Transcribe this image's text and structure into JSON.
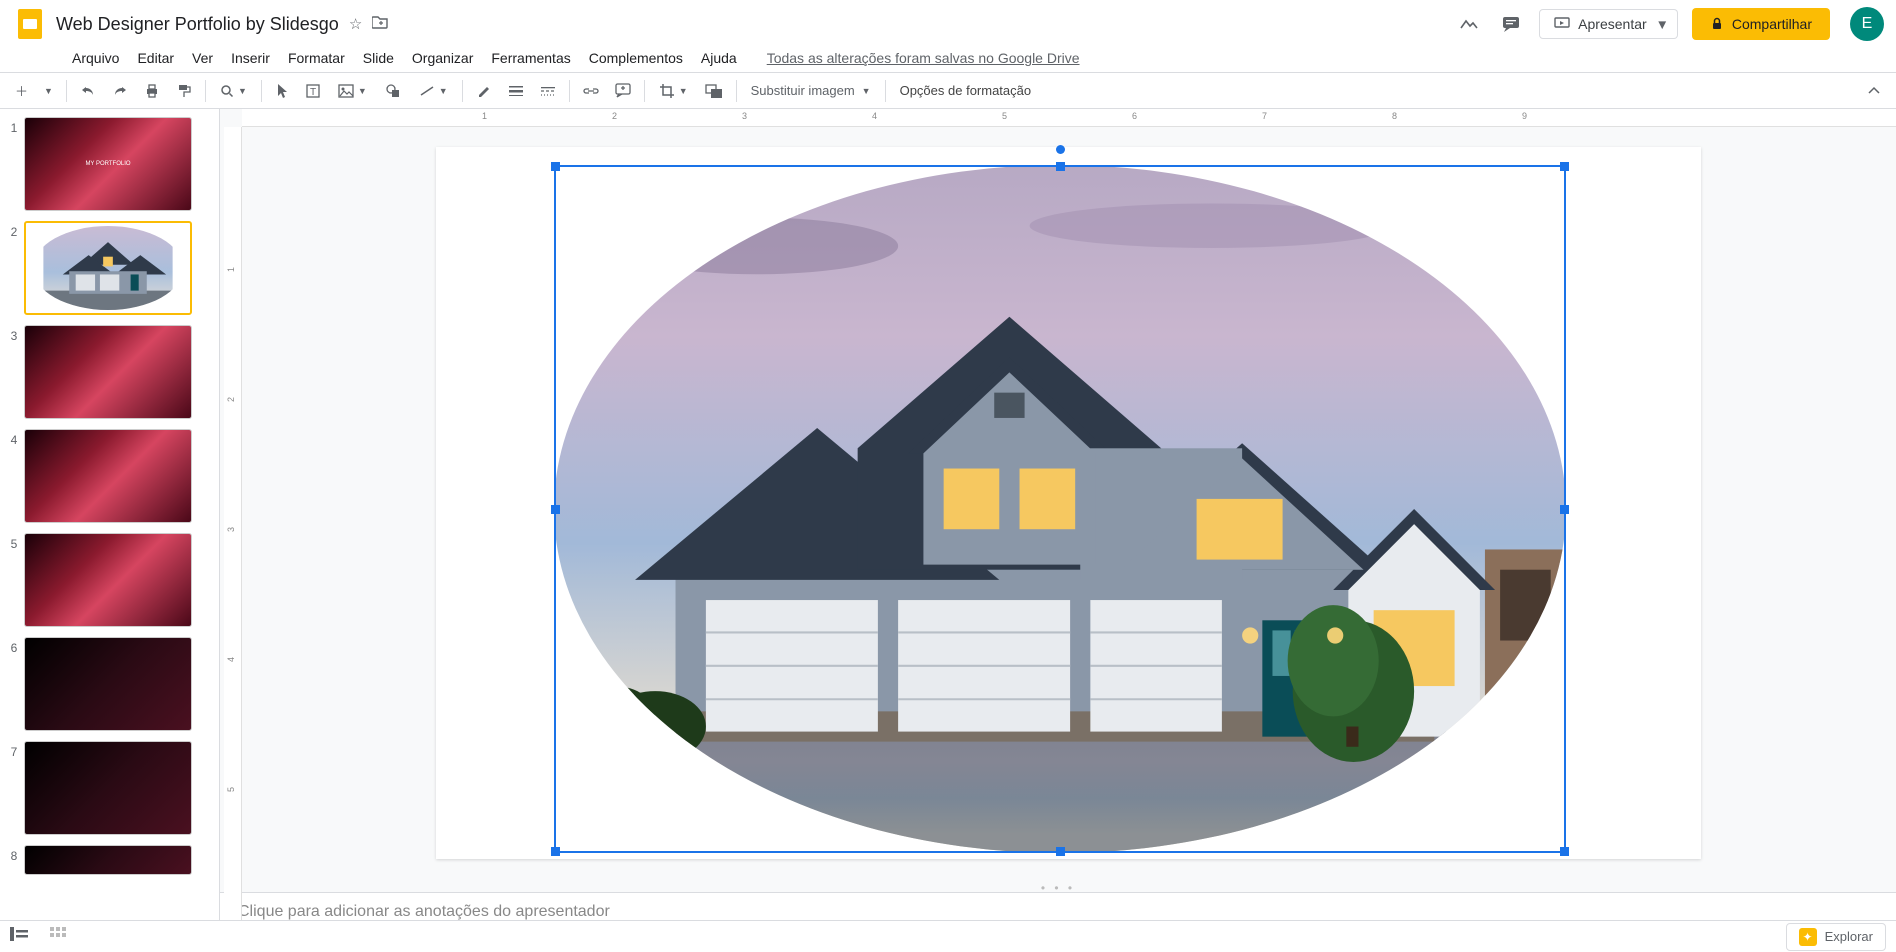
{
  "title": "Web Designer Portfolio by Slidesgo",
  "menubar": [
    "Arquivo",
    "Editar",
    "Ver",
    "Inserir",
    "Formatar",
    "Slide",
    "Organizar",
    "Ferramentas",
    "Complementos",
    "Ajuda"
  ],
  "save_status": "Todas as alterações foram salvas no Google Drive",
  "present_label": "Apresentar",
  "share_label": "Compartilhar",
  "avatar_letter": "E",
  "toolbar": {
    "replace_image": "Substituir imagem",
    "format_options": "Opções de formatação"
  },
  "ruler_h": [
    "",
    "1",
    "2",
    "3",
    "4",
    "5",
    "6",
    "7",
    "8",
    "9"
  ],
  "ruler_v": [
    "1",
    "2",
    "3",
    "4",
    "5"
  ],
  "thumbs": [
    "1",
    "2",
    "3",
    "4",
    "5",
    "6",
    "7",
    "8"
  ],
  "slide1_text": "MY PORTFOLIO",
  "notes_placeholder": "Clique para adicionar as anotações do apresentador",
  "explore_label": "Explorar"
}
